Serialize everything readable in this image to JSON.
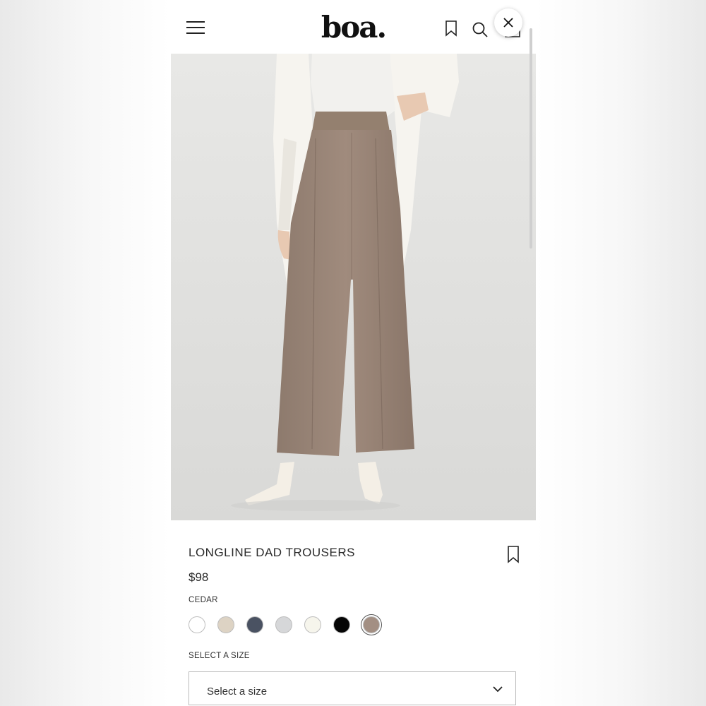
{
  "header": {
    "brand": "boa.",
    "icons": [
      "menu-icon",
      "bookmark-icon",
      "search-icon",
      "bag-icon",
      "close-icon"
    ]
  },
  "product": {
    "title": "LONGLINE DAD TROUSERS",
    "price": "$98",
    "selected_color": "CEDAR",
    "swatches": [
      {
        "color": "#ffffff",
        "selected": false
      },
      {
        "color": "#ddd3c4",
        "selected": false
      },
      {
        "color": "#4a5262",
        "selected": false
      },
      {
        "color": "#d6d7d9",
        "selected": false
      },
      {
        "color": "#f6f5ec",
        "selected": false
      },
      {
        "color": "#050505",
        "selected": false
      },
      {
        "color": "#a38f83",
        "selected": true
      }
    ],
    "size_label": "SELECT A SIZE",
    "size_select_value": "Select a size"
  },
  "colors": {
    "trousers": "#9c8778",
    "background_photo": "#e6e6e4",
    "accent_text": "#2a2a2a"
  }
}
